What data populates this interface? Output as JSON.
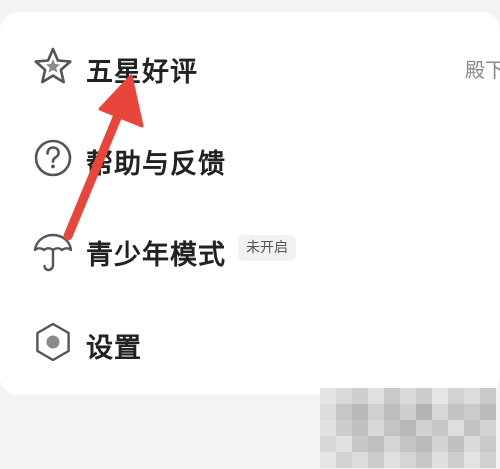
{
  "menu": {
    "items": [
      {
        "label": "五星好评",
        "icon": "star-icon",
        "right_text": "殿下"
      },
      {
        "label": "帮助与反馈",
        "icon": "question-icon"
      },
      {
        "label": "青少年模式",
        "icon": "umbrella-icon",
        "badge": "未开启"
      },
      {
        "label": "设置",
        "icon": "hexagon-gear-icon"
      }
    ]
  },
  "annotation": {
    "arrow_color": "#e8463a"
  },
  "colors": {
    "background": "#f3f3f3",
    "card": "#ffffff",
    "text": "#222222",
    "icon": "#555555"
  }
}
